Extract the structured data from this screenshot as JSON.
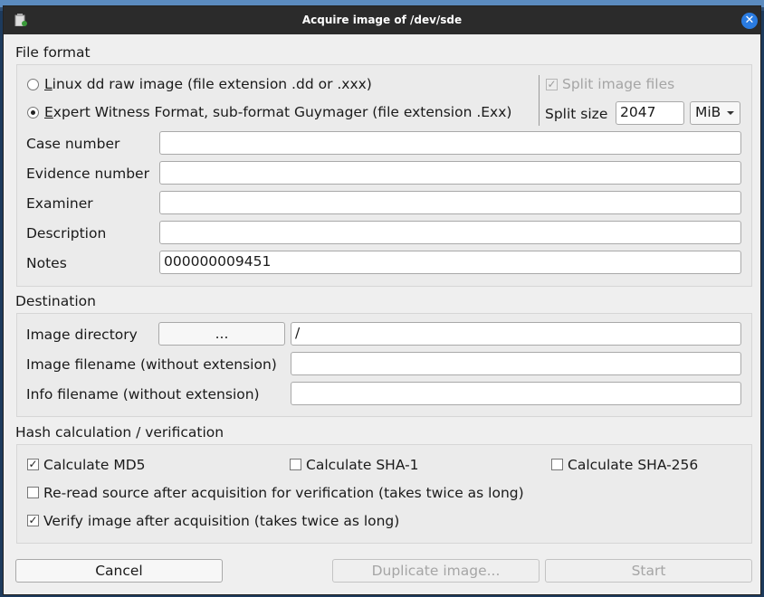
{
  "window": {
    "title": "Acquire image of /dev/sde",
    "app_icon": "clipboard-icon",
    "close_icon": "close-icon"
  },
  "file_format": {
    "section_label": "File format",
    "radio_dd": {
      "mnemonic": "L",
      "label": "inux dd raw image (file extension .dd or .xxx)",
      "selected": false
    },
    "radio_ewf": {
      "mnemonic": "E",
      "label": "xpert Witness Format, sub-format Guymager (file extension .Exx)",
      "selected": true
    },
    "split_image_files": {
      "label": "Split image files",
      "checked": true,
      "enabled": false
    },
    "split_size": {
      "label": "Split size",
      "value": "2047",
      "unit": "MiB"
    },
    "fields": [
      {
        "label": "Case number",
        "value": ""
      },
      {
        "label": "Evidence number",
        "value": ""
      },
      {
        "label": "Examiner",
        "value": ""
      },
      {
        "label": "Description",
        "value": ""
      },
      {
        "label": "Notes",
        "value": "000000009451"
      }
    ]
  },
  "destination": {
    "section_label": "Destination",
    "image_directory": {
      "label": "Image directory",
      "button": "...",
      "value": "/"
    },
    "image_filename": {
      "label": "Image filename (without extension)",
      "value": ""
    },
    "info_filename": {
      "label": "Info filename (without extension)",
      "value": ""
    }
  },
  "hash": {
    "section_label": "Hash calculation / verification",
    "md5": {
      "label": "Calculate MD5",
      "checked": true
    },
    "sha1": {
      "label": "Calculate SHA-1",
      "checked": false
    },
    "sha256": {
      "label": "Calculate SHA-256",
      "checked": false
    },
    "reread": {
      "label": "Re-read source after acquisition for verification (takes twice as long)",
      "checked": false
    },
    "verify": {
      "label": "Verify image after acquisition (takes twice as long)",
      "checked": true
    }
  },
  "buttons": {
    "cancel": "Cancel",
    "duplicate": "Duplicate image...",
    "start": "Start"
  },
  "check_mark": "✓"
}
